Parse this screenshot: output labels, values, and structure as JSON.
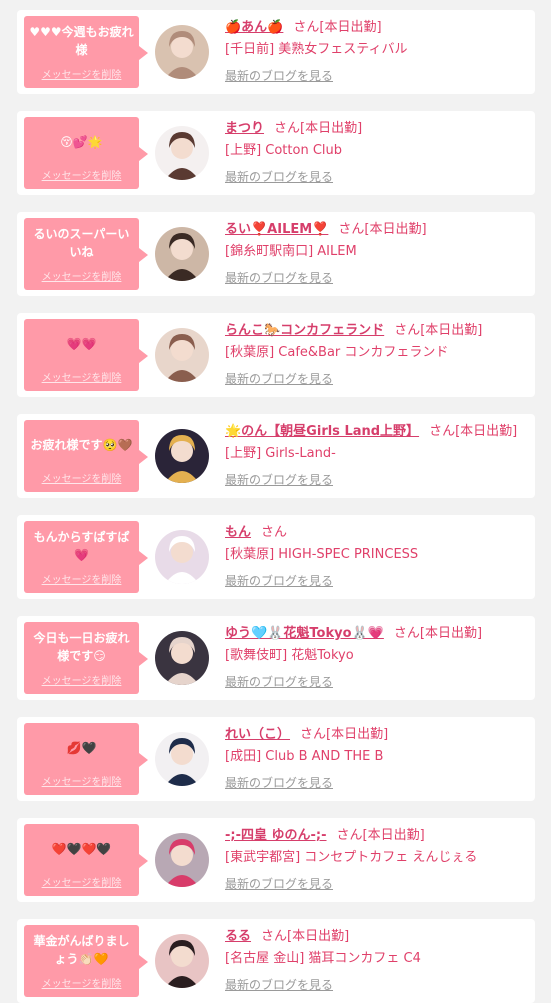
{
  "delete_label": "メッセージを削除",
  "san_label": "さん",
  "blog_label": "最新のブログを見る",
  "items": [
    {
      "message": "♥♥♥今週もお疲れ様",
      "name": "🍎あん🍎",
      "status": "[本日出勤]",
      "shop": "[千日前] 美熟女フェスティバル",
      "avatar_color": "#d9c2b0",
      "avatar_accent": "#b08c7a"
    },
    {
      "message": "😚💕🌟",
      "name": "まつり",
      "status": "[本日出勤]",
      "shop": "[上野] Cotton Club",
      "avatar_color": "#f4f0f0",
      "avatar_accent": "#5a3a32"
    },
    {
      "message": "るいのスーパーいいね",
      "name": "るい❣️AILEM❣️",
      "status": "[本日出勤]",
      "shop": "[錦糸町駅南口] AILEM",
      "avatar_color": "#cdb7a6",
      "avatar_accent": "#3a2a24"
    },
    {
      "message": "💗💗",
      "name": "らんこ🐎コンカフェランド",
      "status": "[本日出勤]",
      "shop": "[秋葉原] Cafe&Bar コンカフェランド",
      "avatar_color": "#e8d6cb",
      "avatar_accent": "#8a5e4e"
    },
    {
      "message": "お疲れ様です🥺🤎",
      "name": "🌟のん【朝昼Girls Land上野】",
      "status": "[本日出勤]",
      "shop": "[上野] Girls-Land-",
      "avatar_color": "#2a2438",
      "avatar_accent": "#e4b050"
    },
    {
      "message": "もんからすぱすぱ💗",
      "name": "もん",
      "status": "",
      "shop": "[秋葉原] HIGH-SPEC PRINCESS",
      "avatar_color": "#e8dbe8",
      "avatar_accent": "#ffffff"
    },
    {
      "message": "今日も一日お疲れ様です😏",
      "name": "ゆう🩵🐰花魁Tokyo🐰💗",
      "status": "[本日出勤]",
      "shop": "[歌舞伎町] 花魁Tokyo",
      "avatar_color": "#3a3440",
      "avatar_accent": "#e6d4cc"
    },
    {
      "message": "💋🖤",
      "name": "れい（こ）",
      "status": "[本日出勤]",
      "shop": "[成田] Club B AND THE B",
      "avatar_color": "#f2f0f2",
      "avatar_accent": "#1e2c4a"
    },
    {
      "message": "❤️🖤❤️🖤",
      "name": "-;-四皇 ゆのん-;-",
      "status": "[本日出勤]",
      "shop": "[東武宇都宮] コンセプトカフェ えんじぇる",
      "avatar_color": "#b8a8b4",
      "avatar_accent": "#d83c6a"
    },
    {
      "message": "華金がんばりましょう👏🏻🧡",
      "name": "るる",
      "status": "[本日出勤]",
      "shop": "[名古屋 金山] 猫耳コンカフェ C4",
      "avatar_color": "#e8c4c4",
      "avatar_accent": "#2a1e20"
    }
  ]
}
